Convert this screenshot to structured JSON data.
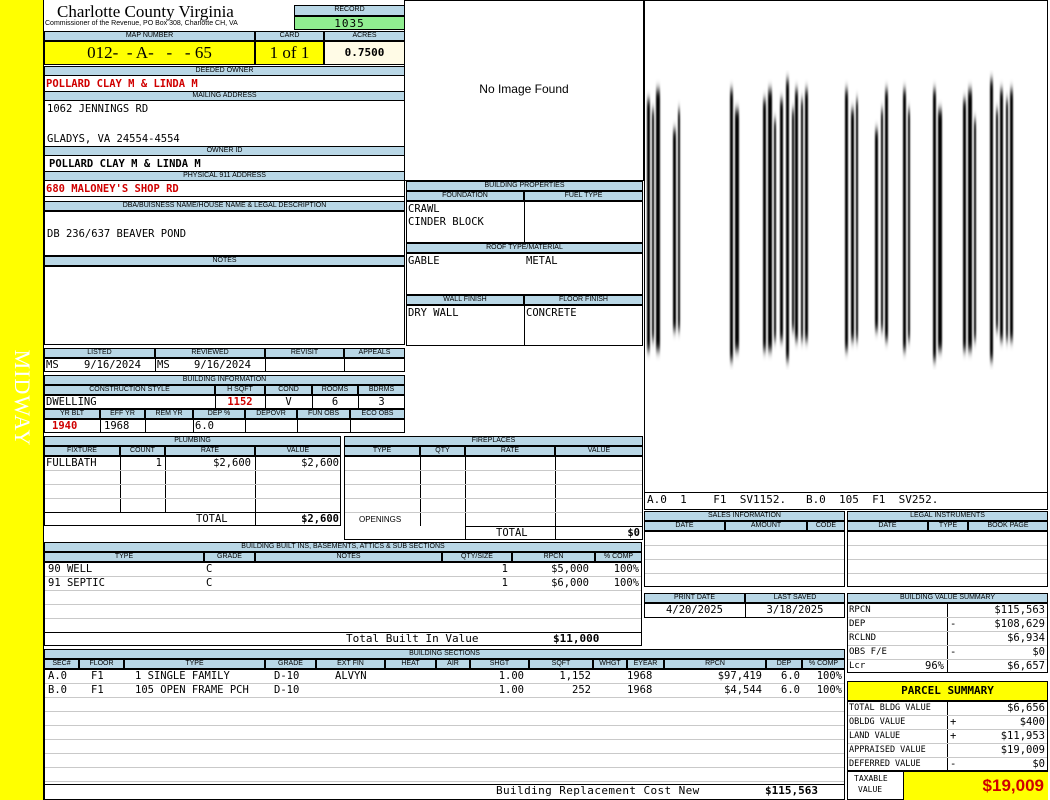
{
  "sidebar": {
    "district": "MIDWAY",
    "color": "#ffff00"
  },
  "header": {
    "county": "Charlotte County Virginia",
    "commissioner": "Commissioner of the Revenue, PO Box 308, Charlotte CH, VA",
    "record_label": "RECORD",
    "record": "1035",
    "map_label": "MAP NUMBER",
    "map": "012-  - A-   -   - 65",
    "card_label": "CARD",
    "card": "1 of 1",
    "acres_label": "ACRES",
    "acres": "0.7500"
  },
  "owner": {
    "deeded_label": "DEEDED OWNER",
    "deeded": "POLLARD CLAY M & LINDA M",
    "mailing_label": "MAILING ADDRESS",
    "mail1": "1062 JENNINGS RD",
    "mail2": "GLADYS, VA 24554-4554",
    "ownerid_label": "OWNER ID",
    "ownerid": "POLLARD CLAY M & LINDA M",
    "phys_label": "PHYSICAL 911 ADDRESS",
    "phys": "680 MALONEY'S SHOP RD",
    "dba_label": "DBA/BUISNESS NAME/HOUSE NAME & LEGAL DESCRIPTION",
    "dba": "DB 236/637 BEAVER POND",
    "notes_label": "NOTES"
  },
  "photo": {
    "text": "No Image Found"
  },
  "sketch": {
    "caption": "A.0  1    F1  SV1152.   B.0  105  F1  SV252.",
    "stripe_color": "#000000"
  },
  "building_props": {
    "title": "BUILDING PROPERTIES",
    "foundation_label": "FOUNDATION",
    "fuel_label": "FUEL TYPE",
    "foundation1": "CRAWL",
    "foundation2": "CINDER BLOCK",
    "roof_label": "ROOF TYPE/MATERIAL",
    "roof_type": "GABLE",
    "roof_mat": "METAL",
    "wall_label": "WALL FINISH",
    "floor_label": "FLOOR FINISH",
    "wall": "DRY WALL",
    "floor": "CONCRETE"
  },
  "status": {
    "listed_label": "LISTED",
    "reviewed_label": "REVIEWED",
    "revisit_label": "REVISIT",
    "appeals_label": "APPEALS",
    "listed_by": "MS",
    "listed_date": "9/16/2024",
    "reviewed_by": "MS",
    "reviewed_date": "9/16/2024"
  },
  "building_info": {
    "title": "BUILDING INFORMATION",
    "style_label": "CONSTRUCTION STYLE",
    "hsqft_label": "H SQFT",
    "cond_label": "COND",
    "rooms_label": "ROOMS",
    "bdrms_label": "BDRMS",
    "style": "DWELLING",
    "hsqft": "1152",
    "cond": "V",
    "rooms": "6",
    "bdrms": "3",
    "yrblt_label": "YR BLT",
    "effyr_label": "EFF YR",
    "remyr_label": "REM YR",
    "dep_label": "DEP %",
    "depovr_label": "DEPOVR",
    "funobs_label": "FUN OBS",
    "ecoobs_label": "ECO OBS",
    "yrblt": "1940",
    "effyr": "1968",
    "dep": "6.0"
  },
  "plumbing": {
    "title": "PLUMBING",
    "h_fixture": "FIXTURE",
    "h_count": "COUNT",
    "h_rate": "RATE",
    "h_value": "VALUE",
    "rows": [
      {
        "fixture": "FULLBATH",
        "count": "1",
        "rate": "$2,600",
        "value": "$2,600"
      }
    ],
    "total_label": "TOTAL",
    "total": "$2,600"
  },
  "fireplaces": {
    "title": "FIREPLACES",
    "h_type": "TYPE",
    "h_qty": "QTY",
    "h_rate": "RATE",
    "h_value": "VALUE",
    "openings_label": "OPENINGS",
    "total_label": "TOTAL",
    "total": "$0"
  },
  "builtins": {
    "title": "BUILDING BUILT INS, BASEMENTS, ATTICS & SUB SECTIONS",
    "h_type": "TYPE",
    "h_grade": "GRADE",
    "h_notes": "NOTES",
    "h_qty": "QTY/SIZE",
    "h_rpcn": "RPCN",
    "h_comp": "% COMP",
    "rows": [
      {
        "type": "90 WELL",
        "grade": "C",
        "qty": "1",
        "rpcn": "$5,000",
        "comp": "100%"
      },
      {
        "type": "91 SEPTIC",
        "grade": "C",
        "qty": "1",
        "rpcn": "$6,000",
        "comp": "100%"
      }
    ],
    "total_label": "Total Built In Value",
    "total": "$11,000"
  },
  "sales": {
    "title": "SALES INFORMATION",
    "h_date": "DATE",
    "h_amount": "AMOUNT",
    "h_code": "CODE"
  },
  "legal": {
    "title": "LEGAL INSTRUMENTS",
    "h_date": "DATE",
    "h_type": "TYPE",
    "h_book": "BOOK PAGE"
  },
  "dates": {
    "print_label": "PRINT DATE",
    "print": "4/20/2025",
    "saved_label": "LAST SAVED",
    "saved": "3/18/2025"
  },
  "value_summary": {
    "title": "BUILDING VALUE SUMMARY",
    "rows": [
      {
        "label": "RPCN",
        "sign": "",
        "value": "$115,563"
      },
      {
        "label": "DEP",
        "sign": "-",
        "value": "$108,629"
      },
      {
        "label": "RCLND",
        "sign": "",
        "value": "$6,934"
      },
      {
        "label": "OBS F/E",
        "sign": "-",
        "value": "$0"
      },
      {
        "label": "Lcr",
        "pct": "96%",
        "sign": "",
        "value": "$6,657"
      }
    ]
  },
  "sections": {
    "title": "BUILDING SECTIONS",
    "headers": [
      "SEC#",
      "FLOOR",
      "TYPE",
      "GRADE",
      "EXT FIN",
      "HEAT",
      "AIR",
      "SHGT",
      "SQFT",
      "WHGT",
      "EYEAR",
      "RPCN",
      "DEP",
      "% COMP"
    ],
    "rows": [
      {
        "sec": "A.0",
        "floor": "F1",
        "type": "1 SINGLE FAMILY",
        "grade": "D-10",
        "extfin": "ALVYN",
        "shgt": "1.00",
        "sqft": "1,152",
        "eyear": "1968",
        "rpcn": "$97,419",
        "dep": "6.0",
        "comp": "100%"
      },
      {
        "sec": "B.0",
        "floor": "F1",
        "type": "105 OPEN FRAME PCH",
        "grade": "D-10",
        "extfin": "",
        "shgt": "1.00",
        "sqft": "252",
        "eyear": "1968",
        "rpcn": "$4,544",
        "dep": "6.0",
        "comp": "100%"
      }
    ],
    "total_label": "Building Replacement Cost New",
    "total": "$115,563"
  },
  "parcel": {
    "title": "PARCEL SUMMARY",
    "rows": [
      {
        "label": "TOTAL BLDG VALUE",
        "sign": "",
        "value": "$6,656"
      },
      {
        "label": "OBLDG VALUE",
        "sign": "+",
        "value": "$400"
      },
      {
        "label": "LAND VALUE",
        "sign": "+",
        "value": "$11,953"
      },
      {
        "label": "APPRAISED VALUE",
        "sign": "",
        "value": "$19,009"
      },
      {
        "label": "DEFERRED VALUE",
        "sign": "-",
        "value": "$0"
      }
    ],
    "taxable_label1": "TAXABLE",
    "taxable_label2": "VALUE",
    "taxable": "$19,009"
  }
}
